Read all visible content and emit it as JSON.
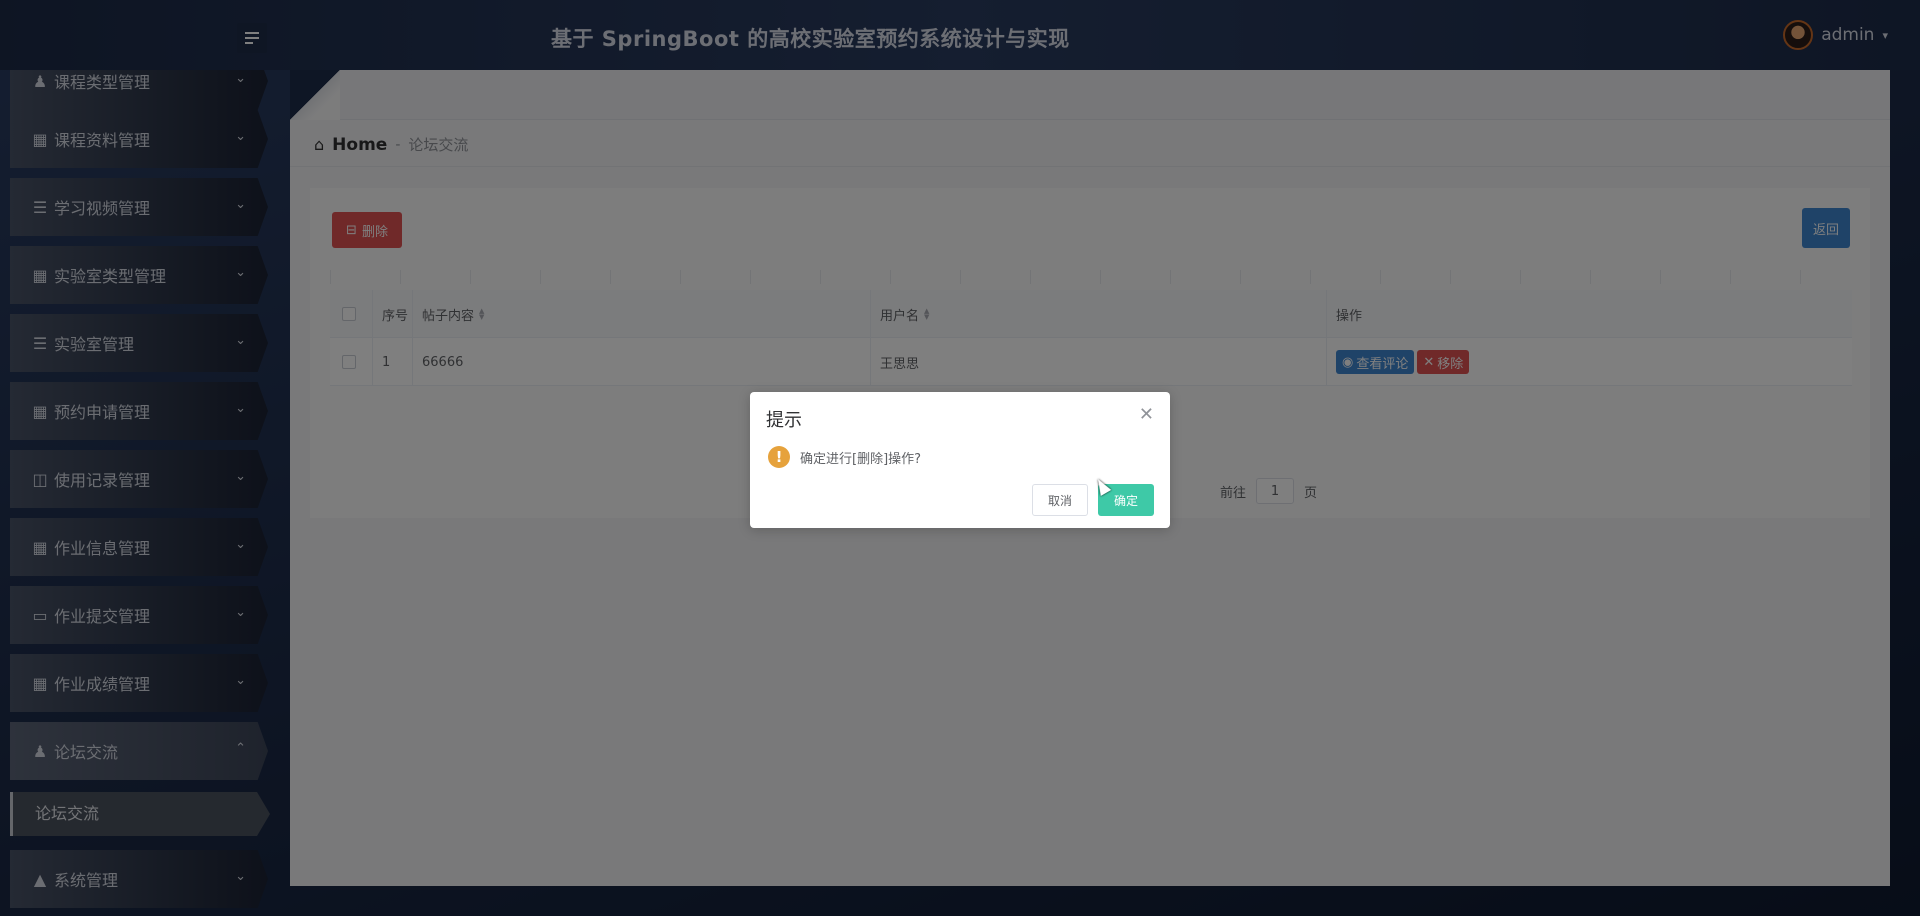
{
  "header": {
    "title": "基于 SpringBoot 的高校实验室预约系统设计与实现",
    "username": "admin",
    "caret": "▾"
  },
  "sidebar": {
    "items": [
      {
        "label": "课程类型管理",
        "icon": "person-icon"
      },
      {
        "label": "课程资料管理",
        "icon": "grid-icon"
      },
      {
        "label": "学习视频管理",
        "icon": "list-icon"
      },
      {
        "label": "实验室类型管理",
        "icon": "grid-icon"
      },
      {
        "label": "实验室管理",
        "icon": "list-icon"
      },
      {
        "label": "预约申请管理",
        "icon": "apps-icon"
      },
      {
        "label": "使用记录管理",
        "icon": "clipboard-icon"
      },
      {
        "label": "作业信息管理",
        "icon": "grid-icon"
      },
      {
        "label": "作业提交管理",
        "icon": "monitor-icon"
      },
      {
        "label": "作业成绩管理",
        "icon": "grid-icon"
      },
      {
        "label": "论坛交流",
        "icon": "person-icon"
      },
      {
        "label": "系统管理",
        "icon": "stamp-icon"
      }
    ],
    "sub_item": "论坛交流"
  },
  "breadcrumb": {
    "home": "Home",
    "separator": "-",
    "current": "论坛交流"
  },
  "toolbar": {
    "delete_label": "删除",
    "back_label": "返回"
  },
  "table": {
    "headers": {
      "index": "序号",
      "content": "帖子内容",
      "username": "用户名",
      "actions": "操作"
    },
    "rows": [
      {
        "index": "1",
        "content": "66666",
        "username": "王思思",
        "view_label": "查看评论",
        "remove_label": "移除"
      }
    ]
  },
  "pager": {
    "goto_label": "前往",
    "page": "1",
    "page_suffix": "页"
  },
  "dialog": {
    "title": "提示",
    "message": "确定进行[删除]操作?",
    "cancel_label": "取消",
    "ok_label": "确定"
  },
  "colors": {
    "danger": "#e05353",
    "primary": "#3e86d1",
    "success": "#3ec9a7",
    "warning": "#e6a23c"
  }
}
